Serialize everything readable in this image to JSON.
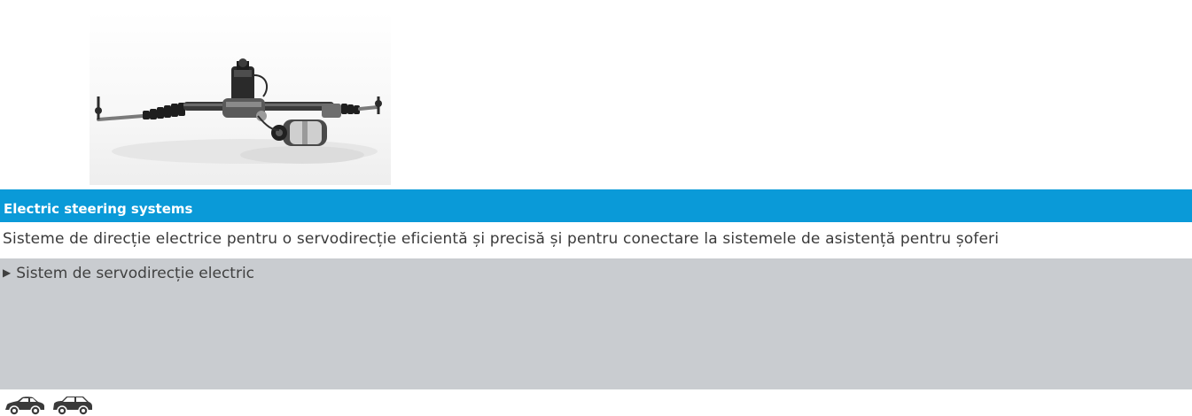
{
  "header": {
    "title": "Electric steering systems"
  },
  "description": "Sisteme de direcție electrice pentru o servodirecție eficientă și precisă și pentru conectare la sistemele de asistență pentru șoferi",
  "panel": {
    "link_arrow": "▶",
    "link_label": "Sistem de servodirecție electric"
  },
  "colors": {
    "header_bg": "#0a9ad8",
    "panel_bg": "#c9ccd0"
  },
  "icons": [
    "passenger-car-icon",
    "suv-icon"
  ]
}
